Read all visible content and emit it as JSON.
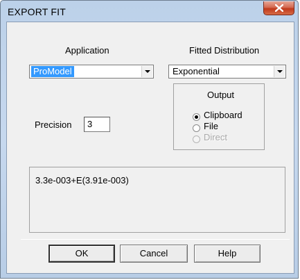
{
  "window": {
    "title": "EXPORT FIT"
  },
  "application": {
    "label": "Application",
    "selected": "ProModel"
  },
  "fitted_distribution": {
    "label": "Fitted Distribution",
    "selected": "Exponential"
  },
  "output": {
    "label": "Output",
    "options": [
      {
        "label": "Clipboard",
        "checked": true,
        "enabled": true
      },
      {
        "label": "File",
        "checked": false,
        "enabled": true
      },
      {
        "label": "Direct",
        "checked": false,
        "enabled": false
      }
    ]
  },
  "precision": {
    "label": "Precision",
    "value": "3"
  },
  "result_text": "3.3e-003+E(3.91e-003)",
  "buttons": {
    "ok": "OK",
    "cancel": "Cancel",
    "help": "Help"
  }
}
